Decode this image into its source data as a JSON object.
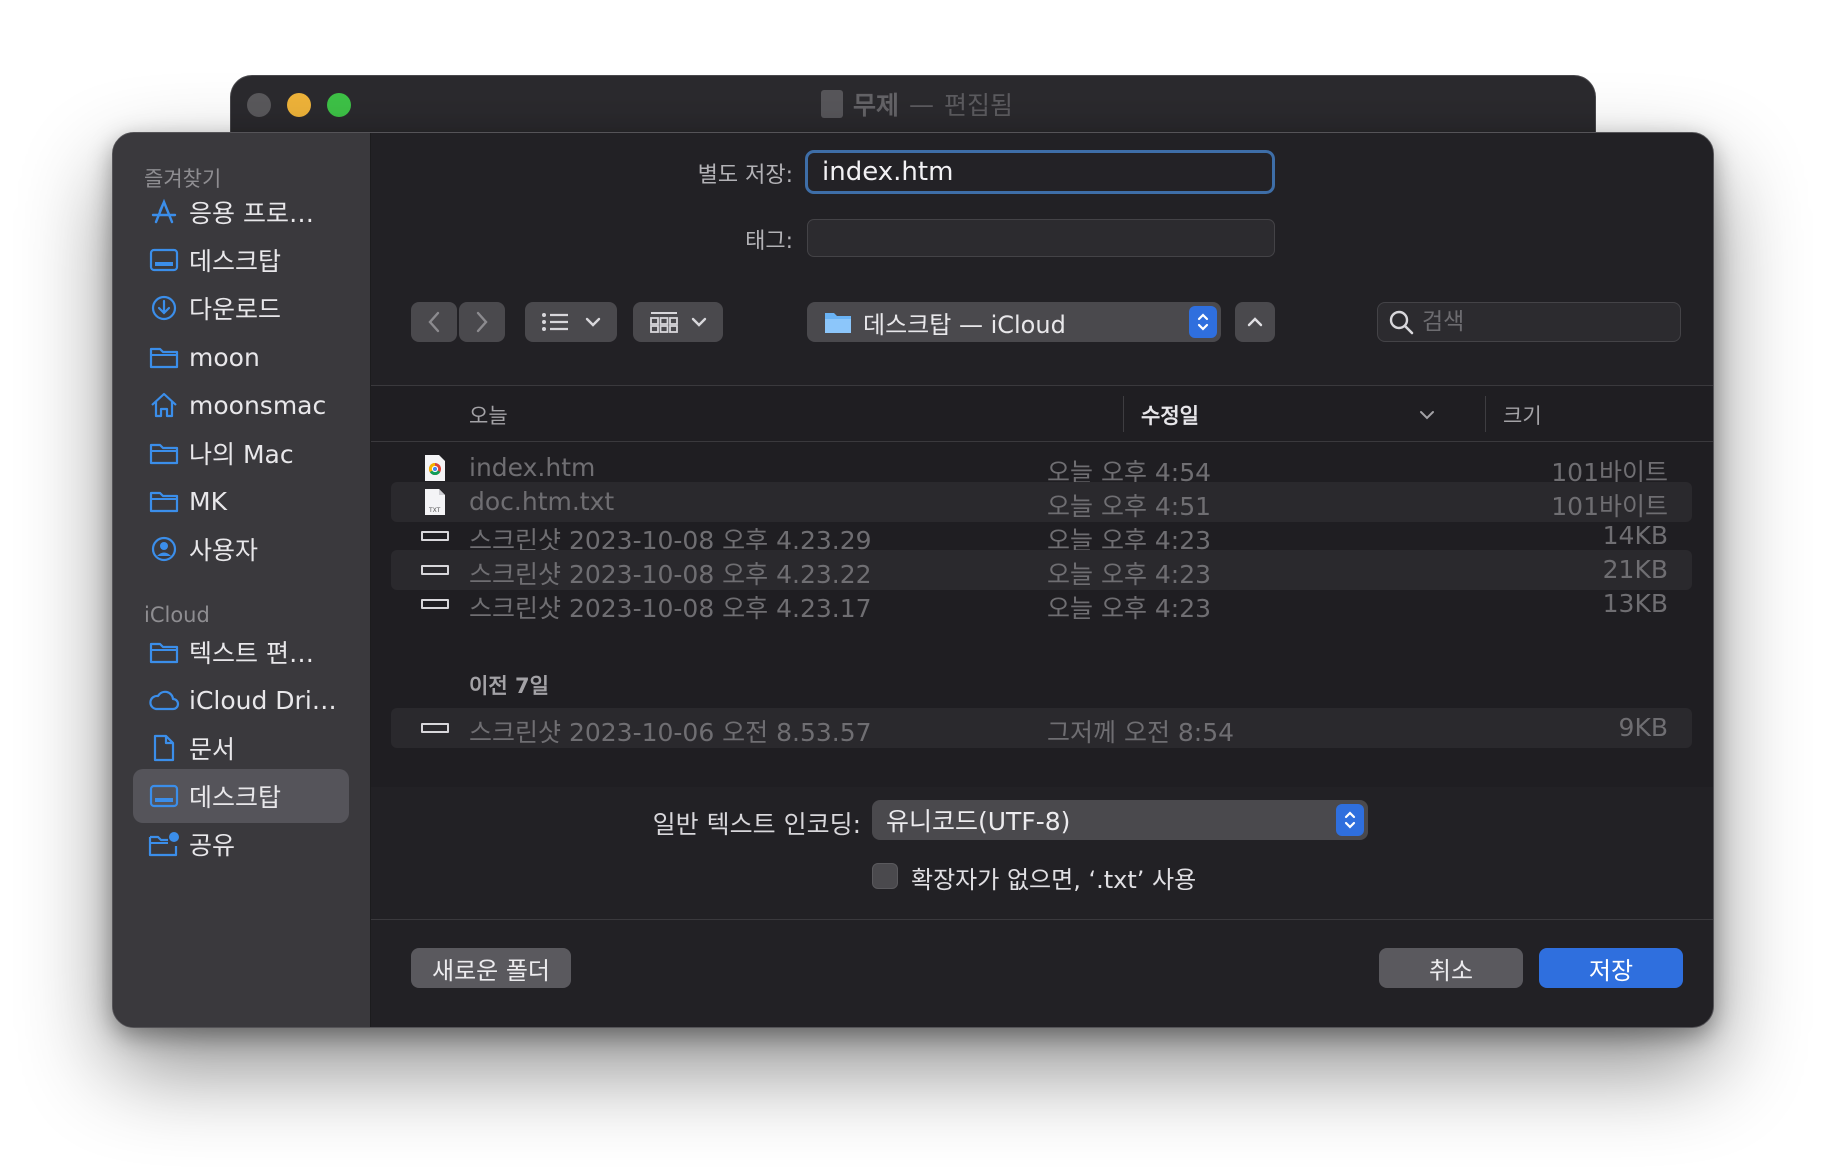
{
  "background_window": {
    "title": "무제",
    "separator": "—",
    "status": "편집됨"
  },
  "sidebar": {
    "favorites_heading": "즐겨찾기",
    "favorites": [
      {
        "label": "응용 프로…",
        "icon": "applications-icon"
      },
      {
        "label": "데스크탑",
        "icon": "desktop-icon"
      },
      {
        "label": "다운로드",
        "icon": "downloads-icon"
      },
      {
        "label": "moon",
        "icon": "folder-icon"
      },
      {
        "label": "moonsmac",
        "icon": "home-icon"
      },
      {
        "label": "나의 Mac",
        "icon": "folder-icon"
      },
      {
        "label": "MK",
        "icon": "folder-icon"
      },
      {
        "label": "사용자",
        "icon": "user-icon"
      }
    ],
    "icloud_heading": "iCloud",
    "icloud": [
      {
        "label": "텍스트 편…",
        "icon": "folder-icon"
      },
      {
        "label": "iCloud Dri…",
        "icon": "cloud-icon"
      },
      {
        "label": "문서",
        "icon": "document-icon"
      },
      {
        "label": "데스크탑",
        "icon": "desktop-icon",
        "selected": true
      },
      {
        "label": "공유",
        "icon": "shared-folder-icon"
      }
    ]
  },
  "form": {
    "save_as_label": "별도 저장:",
    "save_as_value": "index.htm",
    "tags_label": "태그:",
    "tags_value": ""
  },
  "toolbar": {
    "location": "데스크탑 — iCloud",
    "search_placeholder": "검색"
  },
  "columns": {
    "name": "오늘",
    "modified": "수정일",
    "size": "크기"
  },
  "groups": {
    "today": [
      {
        "name": "index.htm",
        "date": "오늘 오후 4:54",
        "size": "101바이트",
        "icon": "chrome-html-icon"
      },
      {
        "name": "doc.htm.txt",
        "date": "오늘 오후 4:51",
        "size": "101바이트",
        "icon": "txt-file-icon"
      },
      {
        "name": "스크린샷 2023-10-08 오후 4.23.29",
        "date": "오늘 오후 4:23",
        "size": "14KB",
        "icon": "screenshot-icon"
      },
      {
        "name": "스크린샷 2023-10-08 오후 4.23.22",
        "date": "오늘 오후 4:23",
        "size": "21KB",
        "icon": "screenshot-icon"
      },
      {
        "name": "스크린샷 2023-10-08 오후 4.23.17",
        "date": "오늘 오후 4:23",
        "size": "13KB",
        "icon": "screenshot-icon"
      }
    ],
    "previous_heading": "이전 7일",
    "previous": [
      {
        "name": "스크린샷 2023-10-06 오전 8.53.57",
        "date": "그저께 오전 8:54",
        "size": "9KB",
        "icon": "screenshot-icon"
      }
    ]
  },
  "encoding": {
    "label": "일반 텍스트 인코딩:",
    "value": "유니코드(UTF-8)",
    "checkbox_label": "확장자가 없으면, ‘.txt’ 사용",
    "checkbox_checked": false
  },
  "buttons": {
    "new_folder": "새로운 폴더",
    "cancel": "취소",
    "save": "저장"
  },
  "colors": {
    "accent": "#2f6fde",
    "focus_ring": "#3e6ea8",
    "sidebar_icon": "#3b8eea"
  }
}
